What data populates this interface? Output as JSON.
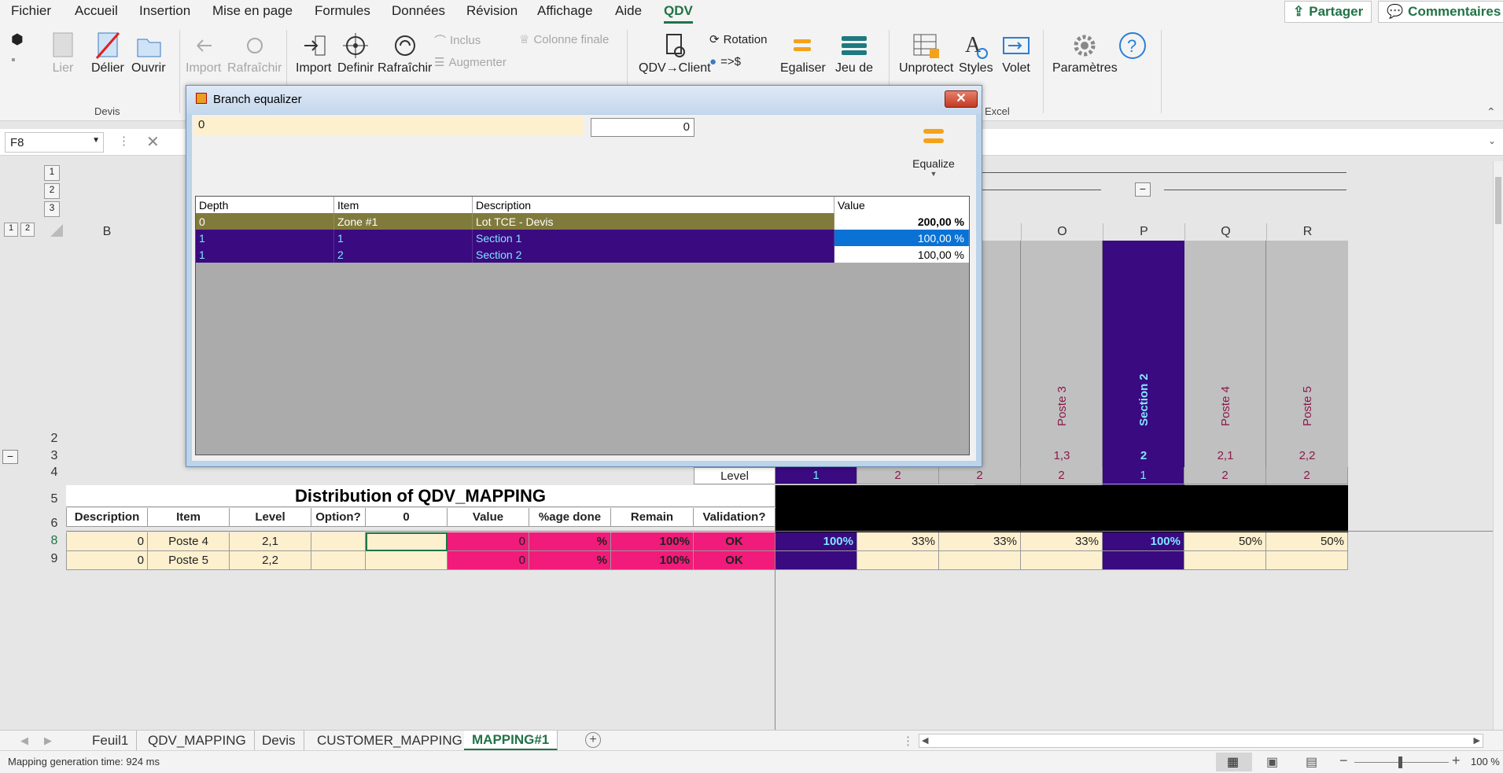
{
  "menu": {
    "items": [
      "Fichier",
      "Accueil",
      "Insertion",
      "Mise en page",
      "Formules",
      "Données",
      "Révision",
      "Affichage",
      "Aide",
      "QDV"
    ],
    "share_label": "Partager",
    "comments_label": "Commentaires"
  },
  "ribbon": {
    "devis": {
      "lier": "Lier",
      "delier": "Délier",
      "ouvrir": "Ouvrir",
      "group": "Devis"
    },
    "import_dis": "Import",
    "refresh_dis": "Rafraîchir",
    "import": "Import",
    "definir": "Definir",
    "rafraichir": "Rafraîchir",
    "inclus": "Inclus",
    "augmenter": "Augmenter",
    "colonne_finale": "Colonne finale",
    "qdv_client": "QDV→Client",
    "rotation": "Rotation",
    "eq_dollar": "=>$",
    "egaliser": "Egaliser",
    "jeu_de": "Jeu de",
    "unprotect": "Unprotect",
    "styles": "Styles",
    "volet": "Volet",
    "group_excel": "Excel",
    "parametres": "Paramètres"
  },
  "formula_bar": {
    "name_box": "F8"
  },
  "grid": {
    "outline_levels": [
      "1",
      "2",
      "3"
    ],
    "col_outline_levels": [
      "1",
      "2"
    ],
    "col_b": "B",
    "right_cols": [
      "O",
      "P",
      "Q",
      "R"
    ],
    "rows": [
      "2",
      "3",
      "4",
      "5",
      "6",
      "8",
      "9"
    ],
    "vertical_labels": [
      "Poste 3",
      "Section 2",
      "Poste 4",
      "Poste 5"
    ],
    "row3_vals": [
      "1,3",
      "2",
      "2,1",
      "2,2"
    ],
    "level_label": "Level",
    "level_vals": [
      "1",
      "2",
      "2",
      "2",
      "1",
      "2",
      "2"
    ],
    "banner_title": "Distribution of QDV_MAPPING",
    "headers": [
      "Description",
      "Item",
      "Level",
      "Option?",
      "0",
      "Value",
      "%age done",
      "Remain",
      "Validation?"
    ],
    "data_rows": [
      {
        "desc": "0",
        "item": "Poste 4",
        "level": "2,1",
        "option": "",
        "zero": "",
        "value": "0",
        "pct": "%",
        "remain": "100%",
        "valid": "OK",
        "dist": [
          "100%",
          "33%",
          "33%",
          "33%",
          "100%",
          "50%",
          "50%"
        ]
      },
      {
        "desc": "0",
        "item": "Poste 5",
        "level": "2,2",
        "option": "",
        "zero": "",
        "value": "0",
        "pct": "%",
        "remain": "100%",
        "valid": "OK",
        "dist": [
          "",
          "",
          "",
          "",
          "",
          "",
          ""
        ]
      }
    ]
  },
  "dialog": {
    "title": "Branch equalizer",
    "input_left": "0",
    "input_right": "0",
    "equalize_label": "Equalize",
    "columns": [
      "Depth",
      "Item",
      "Description",
      "Value"
    ],
    "rows": [
      {
        "depth": "0",
        "item": "Zone #1",
        "description": "Lot TCE - Devis",
        "value": "200,00 %"
      },
      {
        "depth": "1",
        "item": "1",
        "description": "Section 1",
        "value": "100,00 %"
      },
      {
        "depth": "1",
        "item": "2",
        "description": "Section 2",
        "value": "100,00 %"
      }
    ]
  },
  "sheet_tabs": [
    "Feuil1",
    "QDV_MAPPING",
    "Devis",
    "CUSTOMER_MAPPING",
    "MAPPING#1"
  ],
  "status": {
    "text": "Mapping generation time: 924 ms",
    "zoom": "100 %"
  },
  "colors": {
    "accent": "#217346",
    "purple": "#3a0a80",
    "olive": "#807a3c",
    "pink": "#f01b7a",
    "cream": "#fdf0cf",
    "select_blue": "#0a72d4"
  }
}
